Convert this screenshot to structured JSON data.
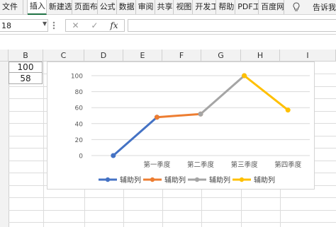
{
  "ribbon": {
    "tabs": [
      {
        "label": "文件",
        "key": "file"
      },
      {
        "label": "插入",
        "key": "insert"
      },
      {
        "label": "新建选",
        "key": "new"
      },
      {
        "label": "页面布",
        "key": "page_layout"
      },
      {
        "label": "公式",
        "key": "formulas"
      },
      {
        "label": "数据",
        "key": "data"
      },
      {
        "label": "审阅",
        "key": "review"
      },
      {
        "label": "共享",
        "key": "share"
      },
      {
        "label": "视图",
        "key": "view"
      },
      {
        "label": "开发工",
        "key": "developer"
      },
      {
        "label": "帮助",
        "key": "help"
      },
      {
        "label": "PDF工",
        "key": "pdf"
      },
      {
        "label": "百度网",
        "key": "baidu"
      }
    ],
    "tell_me": "告诉我"
  },
  "formula_bar": {
    "name_box": "18",
    "cancel_icon": "✕",
    "enter_icon": "✓",
    "fx_label": "fx",
    "formula": ""
  },
  "sheet": {
    "columns": [
      "B",
      "C",
      "D",
      "E",
      "F",
      "G",
      "H",
      "I"
    ],
    "cells": {
      "B_row1": "100",
      "B_row2": "58"
    }
  },
  "chart_data": {
    "type": "line",
    "title": "",
    "xlabel": "",
    "ylabel": "",
    "categories": [
      "",
      "第一季度",
      "第二季度",
      "第三季度",
      "第四季度"
    ],
    "ylim": [
      0,
      100
    ],
    "yticks": [
      0,
      20,
      40,
      60,
      80,
      100
    ],
    "grid": true,
    "legend": "bottom",
    "series": [
      {
        "name": "辅助列",
        "color": "#4472C4",
        "points": [
          [
            0,
            0
          ],
          [
            1,
            48
          ]
        ]
      },
      {
        "name": "辅助列",
        "color": "#ED7D31",
        "points": [
          [
            1,
            48
          ],
          [
            2,
            52
          ]
        ]
      },
      {
        "name": "辅助列",
        "color": "#A5A5A5",
        "points": [
          [
            2,
            52
          ],
          [
            3,
            100
          ]
        ]
      },
      {
        "name": "辅助列",
        "color": "#FFC000",
        "points": [
          [
            3,
            100
          ],
          [
            4,
            57
          ]
        ]
      }
    ]
  }
}
